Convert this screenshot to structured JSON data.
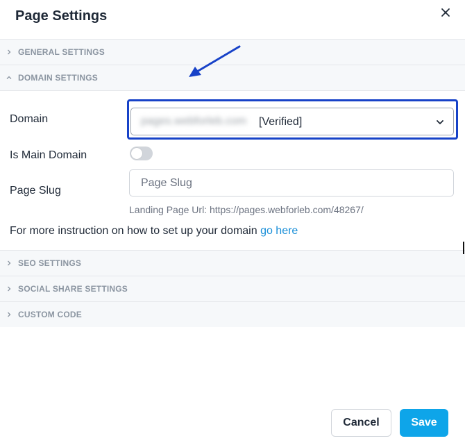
{
  "dialog": {
    "title": "Page Settings",
    "close_icon": "close-icon"
  },
  "sections": {
    "general": {
      "label": "GENERAL SETTINGS",
      "expanded": false
    },
    "domain": {
      "label": "DOMAIN SETTINGS",
      "expanded": true
    },
    "seo": {
      "label": "SEO SETTINGS",
      "expanded": false
    },
    "social": {
      "label": "SOCIAL SHARE SETTINGS",
      "expanded": false
    },
    "custom": {
      "label": "CUSTOM CODE",
      "expanded": false
    }
  },
  "domain_settings": {
    "domain_label": "Domain",
    "domain_value_blurred": "pages.webforleb.com",
    "domain_status": "[Verified]",
    "main_domain_label": "Is Main Domain",
    "main_domain_on": false,
    "slug_label": "Page Slug",
    "slug_value": "",
    "slug_placeholder": "Page Slug",
    "landing_url": "Landing Page Url: https://pages.webforleb.com/48267/",
    "instruction_text": "For more instruction on how to set up your domain ",
    "instruction_link": "go here"
  },
  "footer": {
    "cancel_label": "Cancel",
    "save_label": "Save"
  },
  "colors": {
    "accent": "#0ea5e9",
    "highlight": "#1742c8",
    "link": "#1a8fd8"
  }
}
